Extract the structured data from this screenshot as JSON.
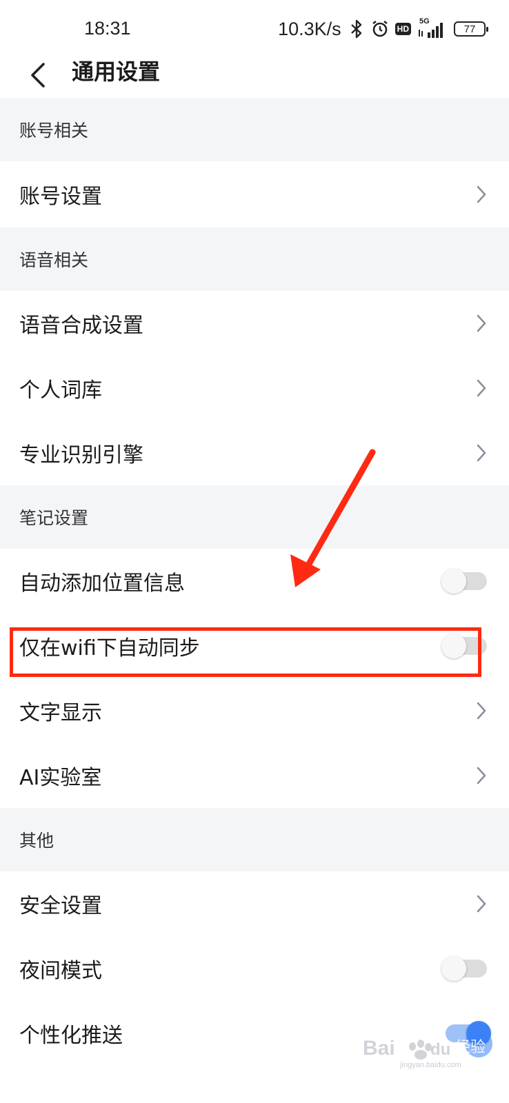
{
  "status_bar": {
    "time": "18:31",
    "network_speed": "10.3K/s",
    "hd_badge": "HD",
    "signal_label": "5G",
    "battery_level": "77",
    "icons": [
      "bluetooth-icon",
      "alarm-icon",
      "hd-icon",
      "signal-icon",
      "battery-icon"
    ]
  },
  "nav": {
    "title": "通用设置",
    "back_icon": "chevron-left-icon"
  },
  "sections": {
    "account": {
      "header": "账号相关",
      "items": [
        {
          "label": "账号设置",
          "control": "chevron"
        }
      ]
    },
    "voice": {
      "header": "语音相关",
      "items": [
        {
          "label": "语音合成设置",
          "control": "chevron"
        },
        {
          "label": "个人词库",
          "control": "chevron"
        },
        {
          "label": "专业识别引擎",
          "control": "chevron"
        }
      ]
    },
    "notes": {
      "header": "笔记设置",
      "items": [
        {
          "label": "自动添加位置信息",
          "control": "toggle",
          "on": false
        },
        {
          "label": "仅在wifi下自动同步",
          "control": "toggle",
          "on": false
        },
        {
          "label": "文字显示",
          "control": "chevron"
        },
        {
          "label": "AI实验室",
          "control": "chevron"
        }
      ]
    },
    "other": {
      "header": "其他",
      "items": [
        {
          "label": "安全设置",
          "control": "chevron"
        },
        {
          "label": "夜间模式",
          "control": "toggle",
          "on": false
        },
        {
          "label": "个性化推送",
          "control": "toggle",
          "on": true
        }
      ]
    }
  },
  "annotation": {
    "color": "#ff2a12",
    "highlighted_item": "仅在wifi下自动同步"
  },
  "watermark": {
    "text_latin": "Bai",
    "text_latin_2": "du",
    "text_cn": "经验",
    "url": "jingyan.baidu.com"
  },
  "colors": {
    "section_bg": "#f4f5f7",
    "text": "#1b1b1b",
    "toggle_off": "#dcdcdc",
    "toggle_on": "#3b82f6"
  }
}
